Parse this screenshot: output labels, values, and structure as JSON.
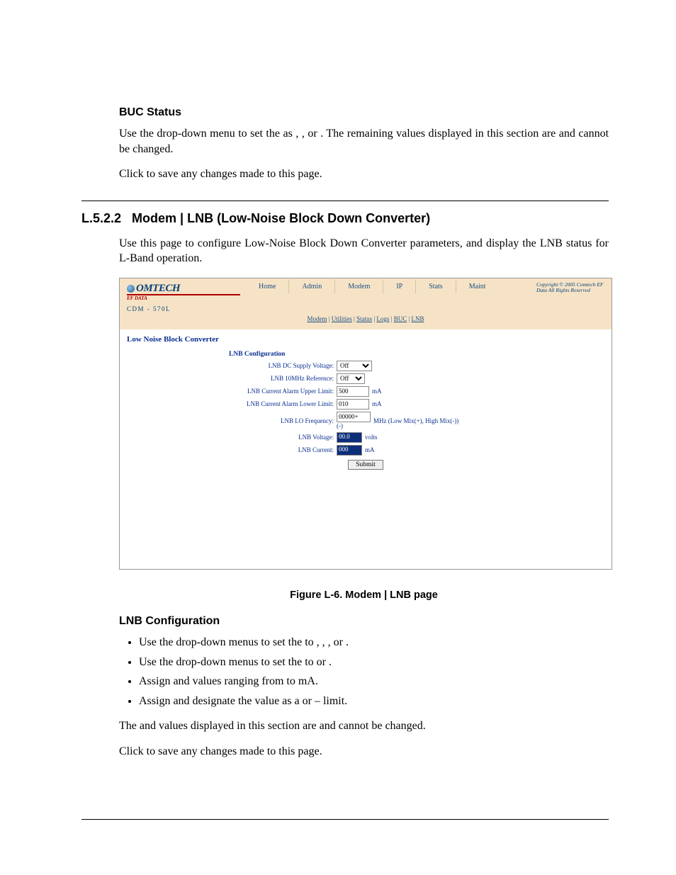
{
  "section_buc": {
    "heading": "BUC Status",
    "p1a": "Use the drop-down menu to set the ",
    "p1b": " as ",
    "p1c": ", ",
    "p1d": ", or ",
    "p1e": ". The remaining values displayed in this section are ",
    "p1f": " and cannot be changed.",
    "p2a": "Click ",
    "p2b": " to save any changes made to this page."
  },
  "section_heading": {
    "num": "L.5.2.2",
    "title": "Modem | LNB (Low-Noise Block Down Converter)"
  },
  "intro": "Use this page to configure Low-Noise Block Down Converter parameters, and display the LNB status for L-Band operation.",
  "webui": {
    "brand": "OMTECH",
    "brand_sub": "EF DATA",
    "model": "CDM - 570L",
    "tabs": [
      "Home",
      "Admin",
      "Modem",
      "IP",
      "Stats",
      "Maint"
    ],
    "copyright": "Copyright © 2005 Comtech EF Data All Rights Reserved",
    "subnav": [
      "Modem",
      "Utilities",
      "Status",
      "Logs",
      "BUC",
      "LNB"
    ],
    "page_title": "Low Noise Block Converter",
    "form_title": "LNB Configuration",
    "rows": {
      "dc_supply": {
        "label": "LNB DC Supply Voltage:",
        "value": "Off"
      },
      "ref10": {
        "label": "LNB 10MHz Reference:",
        "value": "Off"
      },
      "upper": {
        "label": "LNB Current Alarm Upper Limit:",
        "value": "500",
        "unit": "mA"
      },
      "lower": {
        "label": "LNB Current Alarm Lower Limit:",
        "value": "010",
        "unit": "mA"
      },
      "lofreq": {
        "label": "LNB LO Frequency:",
        "value": "00000+",
        "hint": "(-)",
        "unit": "MHz (Low Mix(+), High Mix(-))"
      },
      "voltage": {
        "label": "LNB Voltage:",
        "value": "00.0",
        "unit": "volts"
      },
      "current": {
        "label": "LNB Current:",
        "value": "000",
        "unit": "mA"
      }
    },
    "submit": "Submit"
  },
  "figure_caption": "Figure L-6. Modem | LNB page",
  "section_lnb": {
    "heading": "LNB Configuration",
    "li1a": "Use the drop-down menus to set the ",
    "li1b": " to ",
    "li1c": ", ",
    "li1d": ", ",
    "li1e": ", or ",
    "li1f": ".",
    "li2a": "Use the drop-down menus to set the ",
    "li2b": " to ",
    "li2c": " or ",
    "li2d": ".",
    "li3a": "Assign ",
    "li3b": " and ",
    "li3c": " values ranging from ",
    "li3d": " to ",
    "li3e": " mA.",
    "li4a": "Assign ",
    "li4b": " and designate the value as a ",
    "li4c": " or ",
    "li4d": " – limit.",
    "p1a": "The ",
    "p1b": " and ",
    "p1c": " values displayed in this section are ",
    "p1d": " and cannot be changed.",
    "p2a": "Click ",
    "p2b": " to save any changes made to this page."
  }
}
